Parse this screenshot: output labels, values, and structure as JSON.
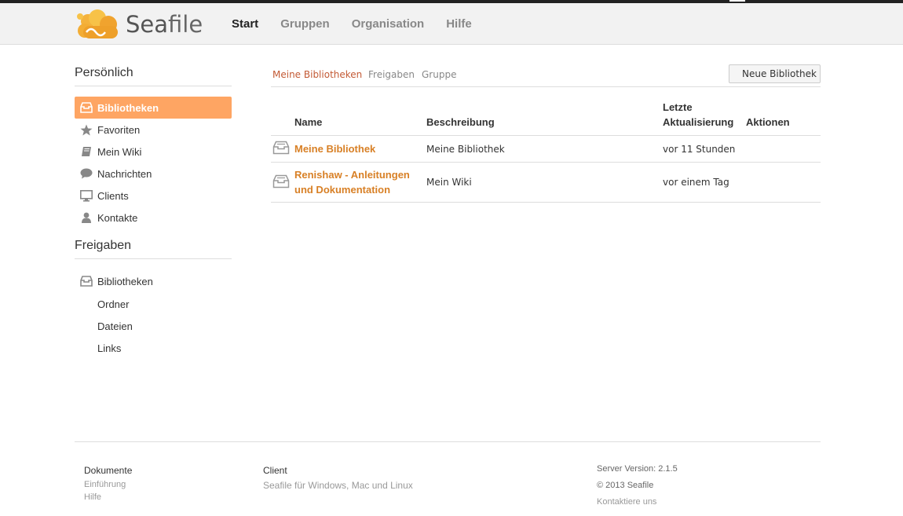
{
  "app": {
    "logo_sea": "Sea",
    "logo_file": "file"
  },
  "topnav": {
    "items": [
      "Start",
      "Gruppen",
      "Organisation",
      "Hilfe"
    ],
    "active": "Start"
  },
  "sidebar": {
    "personal_heading": "Persönlich",
    "personal_items": [
      {
        "label": "Bibliotheken",
        "icon": "library-icon"
      },
      {
        "label": "Favoriten",
        "icon": "star-icon"
      },
      {
        "label": "Mein Wiki",
        "icon": "book-icon"
      },
      {
        "label": "Nachrichten",
        "icon": "chat-bubble-icon"
      },
      {
        "label": "Clients",
        "icon": "monitor-icon"
      },
      {
        "label": "Kontakte",
        "icon": "user-icon"
      }
    ],
    "shares_heading": "Freigaben",
    "shares_items": [
      {
        "label": "Bibliotheken",
        "icon": "library-icon"
      },
      {
        "label": "Ordner"
      },
      {
        "label": "Dateien"
      },
      {
        "label": "Links"
      }
    ]
  },
  "main": {
    "tabs": [
      "Meine Bibliotheken",
      "Freigaben",
      "Gruppe"
    ],
    "active_tab": "Meine Bibliotheken",
    "new_library_button": "Neue Bibliothek",
    "table": {
      "headers": {
        "name": "Name",
        "description": "Beschreibung",
        "updated_line1": "Letzte",
        "updated_line2": "Aktualisierung",
        "actions": "Aktionen"
      },
      "rows": [
        {
          "name": "Meine Bibliothek",
          "name_line2": "",
          "description": "Meine Bibliothek",
          "updated": "vor 11 Stunden"
        },
        {
          "name": "Renishaw - Anleitungen",
          "name_line2": "und Dokumentation",
          "description": "Mein Wiki",
          "updated": "vor einem Tag"
        }
      ]
    }
  },
  "footer": {
    "documents_heading": "Dokumente",
    "documents_links": [
      "Einführung",
      "Hilfe"
    ],
    "client_heading": "Client",
    "client_link": "Seafile für Windows, Mac und Linux",
    "server_version": "Server Version: 2.1.5",
    "copyright": "© 2013 Seafile",
    "contact": "Kontaktiere uns"
  },
  "colors": {
    "accent": "#fea563",
    "link": "#d88026",
    "active_tab": "#c35a35"
  }
}
